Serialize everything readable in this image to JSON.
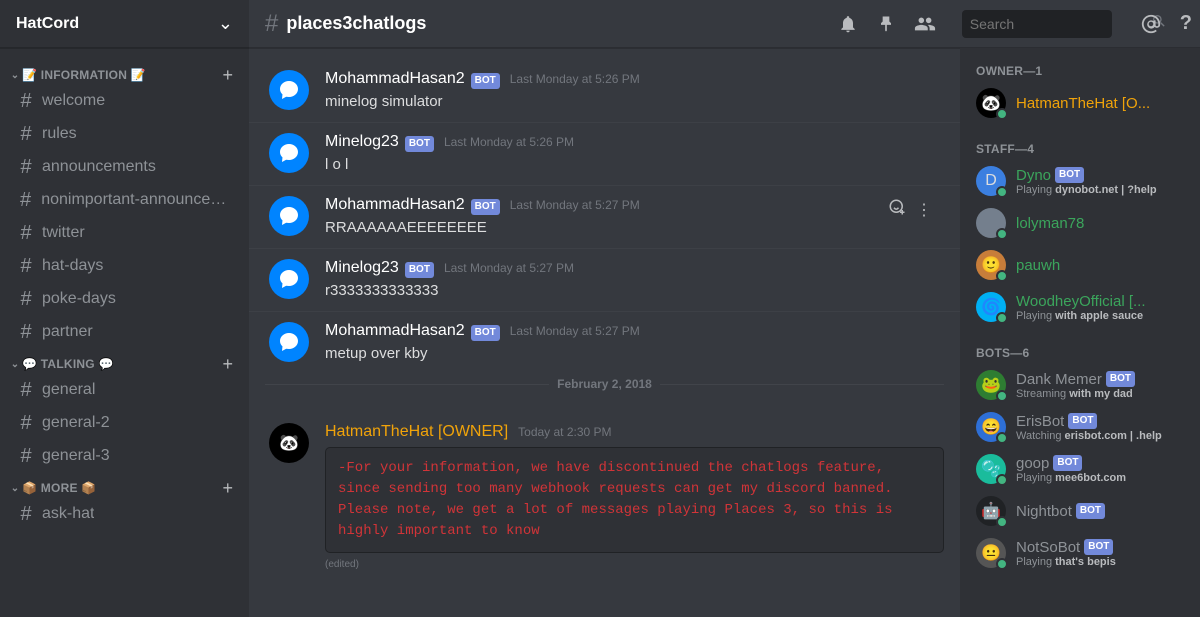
{
  "server": {
    "name": "HatCord"
  },
  "categories": [
    {
      "name": "📝 INFORMATION 📝",
      "channels": [
        "welcome",
        "rules",
        "announcements",
        "nonimportant-announcem...",
        "twitter",
        "hat-days",
        "poke-days",
        "partner"
      ]
    },
    {
      "name": "💬 TALKING 💬",
      "channels": [
        "general",
        "general-2",
        "general-3"
      ]
    },
    {
      "name": "📦 MORE 📦",
      "channels": [
        "ask-hat"
      ]
    }
  ],
  "current_channel": "places3chatlogs",
  "search": {
    "placeholder": "Search"
  },
  "bot_tag": "BOT",
  "messages": [
    {
      "author": "MohammadHasan2",
      "bot": true,
      "time": "Last Monday at 5:26 PM",
      "text": "minelog simulator"
    },
    {
      "author": "Minelog23",
      "bot": true,
      "time": "Last Monday at 5:26 PM",
      "text": "l o l"
    },
    {
      "author": "MohammadHasan2",
      "bot": true,
      "time": "Last Monday at 5:27 PM",
      "text": "RRAAAAAAEEEEEEEE",
      "hover": true
    },
    {
      "author": "Minelog23",
      "bot": true,
      "time": "Last Monday at 5:27 PM",
      "text": "r3333333333333"
    },
    {
      "author": "MohammadHasan2",
      "bot": true,
      "time": "Last Monday at 5:27 PM",
      "text": "metup over kby"
    }
  ],
  "divider_date": "February 2, 2018",
  "owner_message": {
    "author": "HatmanTheHat [OWNER]",
    "time": "Today at 2:30 PM",
    "code": "-For your information, we have discontinued the chatlogs feature, since sending too many webhook requests can get my discord banned. Please note, we get a lot of messages playing Places 3, so this is highly important to know",
    "edited": "(edited)"
  },
  "member_roles": [
    {
      "header": "OWNER—1",
      "members": [
        {
          "name": "HatmanTheHat [O...",
          "color": "#f0a30a",
          "avatar_bg": "#000",
          "avatar_text": "🐼",
          "status": "online"
        }
      ]
    },
    {
      "header": "STAFF—4",
      "members": [
        {
          "name": "Dyno",
          "color": "#3ba55c",
          "bot": true,
          "avatar_bg": "#3b7fe0",
          "avatar_text": "D",
          "status": "online",
          "activity_prefix": "Playing ",
          "activity_bold": "dynobot.net | ?help"
        },
        {
          "name": "lolyman78",
          "color": "#3ba55c",
          "avatar_bg": "#747f8d",
          "avatar_text": "",
          "status": "online"
        },
        {
          "name": "pauwh",
          "color": "#3ba55c",
          "avatar_bg": "#c77d3a",
          "avatar_text": "🙂",
          "status": "online"
        },
        {
          "name": "WoodheyOfficial [...",
          "color": "#3ba55c",
          "avatar_bg": "#00b0f4",
          "avatar_text": "🌀",
          "status": "online",
          "activity_prefix": "Playing ",
          "activity_bold": "with apple sauce"
        }
      ]
    },
    {
      "header": "BOTS—6",
      "members": [
        {
          "name": "Dank Memer",
          "color": "#8e9297",
          "bot": true,
          "avatar_bg": "#2e7d32",
          "avatar_text": "🐸",
          "status": "online",
          "activity_prefix": "Streaming ",
          "activity_bold": "with my dad"
        },
        {
          "name": "ErisBot",
          "color": "#8e9297",
          "bot": true,
          "avatar_bg": "#2e6fd6",
          "avatar_text": "😄",
          "status": "online",
          "activity_prefix": "Watching ",
          "activity_bold": "erisbot.com | .help"
        },
        {
          "name": "goop",
          "color": "#8e9297",
          "bot": true,
          "avatar_bg": "#1abc9c",
          "avatar_text": "🫧",
          "status": "online",
          "activity_prefix": "Playing ",
          "activity_bold": "mee6bot.com"
        },
        {
          "name": "Nightbot",
          "color": "#8e9297",
          "bot": true,
          "avatar_bg": "#202225",
          "avatar_text": "🤖",
          "status": "online"
        },
        {
          "name": "NotSoBot",
          "color": "#8e9297",
          "bot": true,
          "avatar_bg": "#555555",
          "avatar_text": "😐",
          "status": "online",
          "activity_prefix": "Playing ",
          "activity_bold": "that's bepis"
        }
      ]
    }
  ]
}
